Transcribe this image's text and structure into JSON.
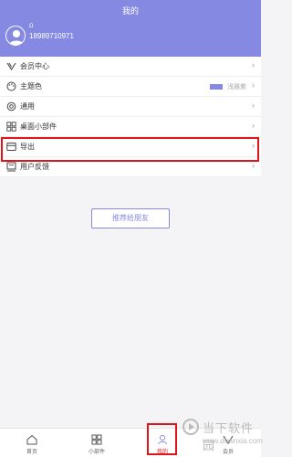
{
  "header": {
    "title": "我的"
  },
  "profile": {
    "vip_mark": "Ω",
    "phone": "18989710971"
  },
  "menu": [
    {
      "label": "会员中心",
      "icon": "vip-icon"
    },
    {
      "label": "主题色",
      "icon": "palette-icon",
      "value": "浅雅紫",
      "swatch": "#8689e1"
    },
    {
      "label": "通用",
      "icon": "settings-icon"
    },
    {
      "label": "桌面小部件",
      "icon": "widget-icon"
    },
    {
      "label": "导出",
      "icon": "export-icon"
    },
    {
      "label": "用户反馈",
      "icon": "feedback-icon"
    }
  ],
  "recommend_button": "推荐给朋友",
  "tabs": [
    {
      "label": "首页",
      "icon": "home-icon"
    },
    {
      "label": "小部件",
      "icon": "widget-icon"
    },
    {
      "label": "我的",
      "icon": "user-icon",
      "active": true
    },
    {
      "label": "会员",
      "icon": "vip-icon"
    }
  ],
  "watermark": {
    "name": "当下软件园",
    "url": "www.downxia.com"
  },
  "colors": {
    "accent": "#8689e1",
    "highlight": "#e0151a"
  }
}
